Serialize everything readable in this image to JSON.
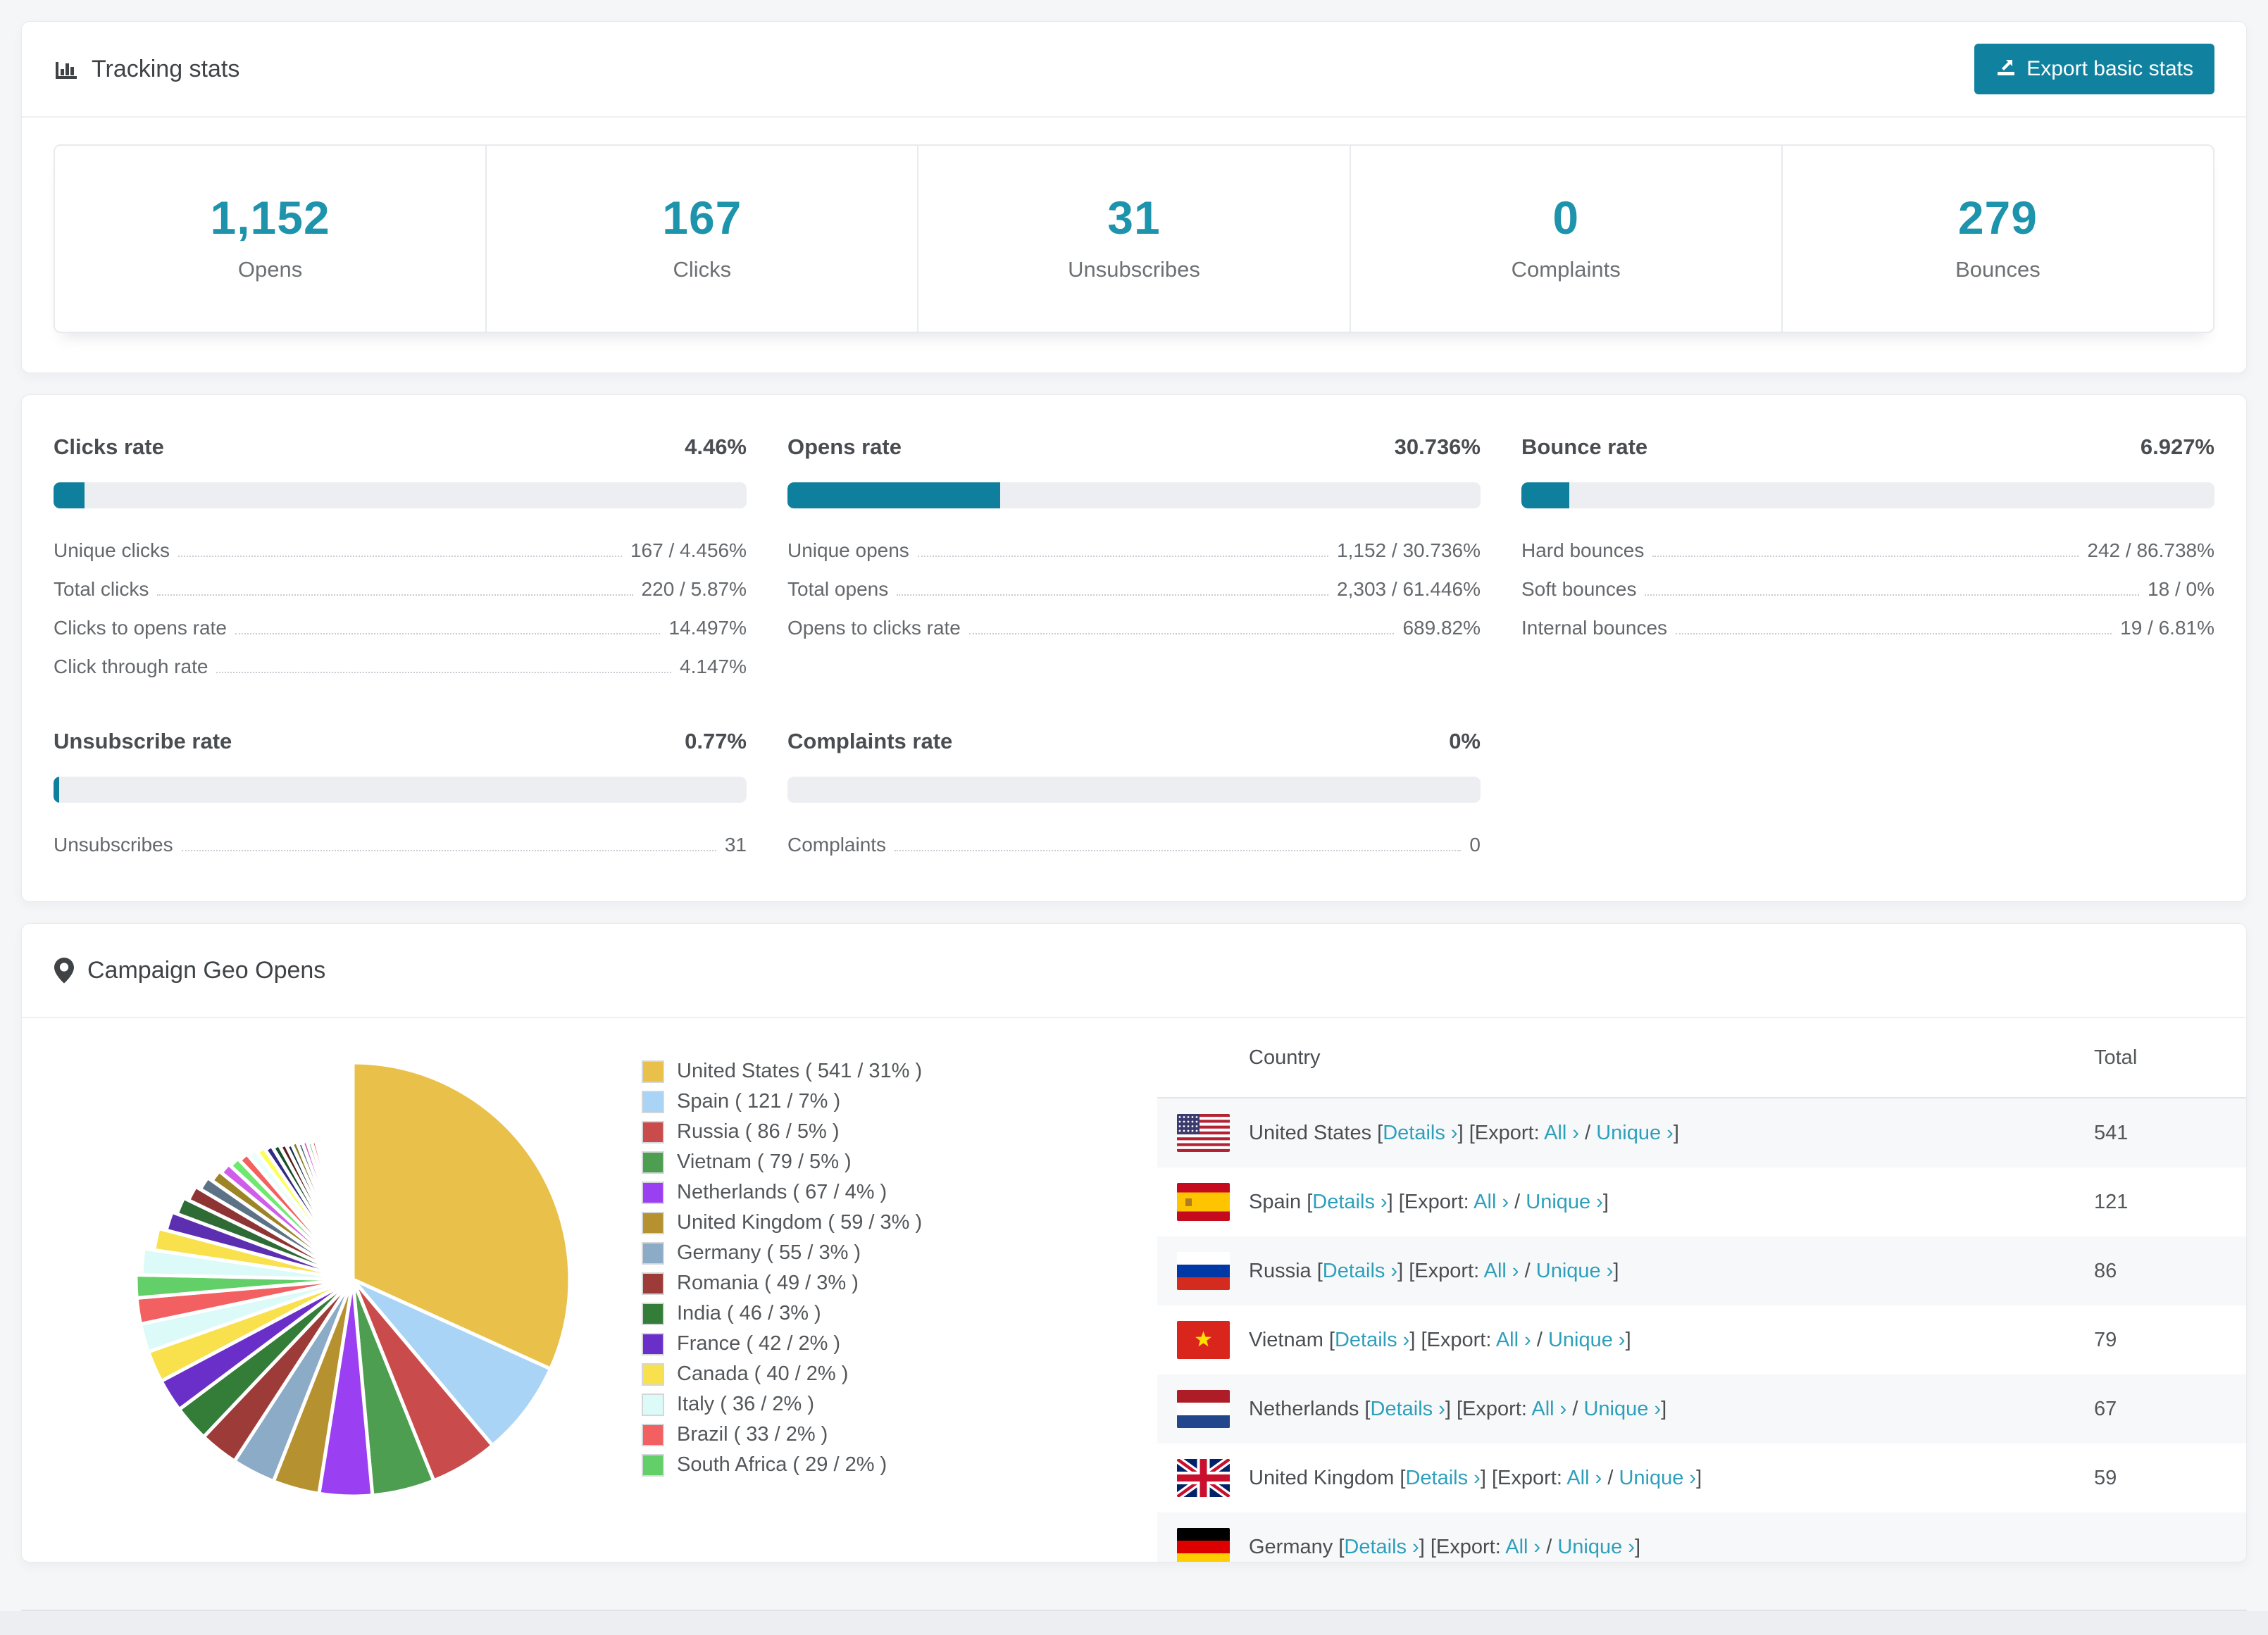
{
  "tracking": {
    "title": "Tracking stats",
    "export_button": "Export basic stats",
    "stats": [
      {
        "value": "1,152",
        "label": "Opens"
      },
      {
        "value": "167",
        "label": "Clicks"
      },
      {
        "value": "31",
        "label": "Unsubscribes"
      },
      {
        "value": "0",
        "label": "Complaints"
      },
      {
        "value": "279",
        "label": "Bounces"
      }
    ]
  },
  "rates": [
    {
      "title": "Clicks rate",
      "value": "4.46%",
      "pct": 4.46,
      "rows": [
        [
          "Unique clicks",
          "167 / 4.456%"
        ],
        [
          "Total clicks",
          "220 / 5.87%"
        ],
        [
          "Clicks to opens rate",
          "14.497%"
        ],
        [
          "Click through rate",
          "4.147%"
        ]
      ]
    },
    {
      "title": "Opens rate",
      "value": "30.736%",
      "pct": 30.736,
      "rows": [
        [
          "Unique opens",
          "1,152 / 30.736%"
        ],
        [
          "Total opens",
          "2,303 / 61.446%"
        ],
        [
          "Opens to clicks rate",
          "689.82%"
        ]
      ]
    },
    {
      "title": "Bounce rate",
      "value": "6.927%",
      "pct": 6.927,
      "rows": [
        [
          "Hard bounces",
          "242 / 86.738%"
        ],
        [
          "Soft bounces",
          "18 / 0%"
        ],
        [
          "Internal bounces",
          "19 / 6.81%"
        ]
      ]
    },
    {
      "title": "Unsubscribe rate",
      "value": "0.77%",
      "pct": 0.77,
      "rows": [
        [
          "Unsubscribes",
          "31"
        ]
      ]
    },
    {
      "title": "Complaints rate",
      "value": "0%",
      "pct": 0,
      "rows": [
        [
          "Complaints",
          "0"
        ]
      ]
    }
  ],
  "geo": {
    "title": "Campaign Geo Opens",
    "chart_data": {
      "type": "pie",
      "title": "Campaign Geo Opens",
      "legend_position": "right",
      "slices": [
        {
          "label": "United States",
          "value": 541,
          "pct": 31,
          "color": "#e8c04a"
        },
        {
          "label": "Spain",
          "value": 121,
          "pct": 7,
          "color": "#aad4f5"
        },
        {
          "label": "Russia",
          "value": 86,
          "pct": 5,
          "color": "#c94b4b"
        },
        {
          "label": "Vietnam",
          "value": 79,
          "pct": 5,
          "color": "#4d9e50"
        },
        {
          "label": "Netherlands",
          "value": 67,
          "pct": 4,
          "color": "#9b3ff2"
        },
        {
          "label": "United Kingdom",
          "value": 59,
          "pct": 3,
          "color": "#b5922f"
        },
        {
          "label": "Germany",
          "value": 55,
          "pct": 3,
          "color": "#8cabc6"
        },
        {
          "label": "Romania",
          "value": 49,
          "pct": 3,
          "color": "#9d3b38"
        },
        {
          "label": "India",
          "value": 46,
          "pct": 3,
          "color": "#337d39"
        },
        {
          "label": "France",
          "value": 42,
          "pct": 2,
          "color": "#6a2fc9"
        },
        {
          "label": "Canada",
          "value": 40,
          "pct": 2,
          "color": "#f8e14c"
        },
        {
          "label": "Italy",
          "value": 36,
          "pct": 2,
          "color": "#dbfaf8"
        },
        {
          "label": "Brazil",
          "value": 33,
          "pct": 2,
          "color": "#f26061"
        },
        {
          "label": "South Africa",
          "value": 29,
          "pct": 2,
          "color": "#63cf69"
        }
      ],
      "others_tail_values": [
        34,
        30,
        27,
        25,
        23,
        21,
        19,
        18,
        17,
        16,
        15,
        14,
        13,
        12,
        11,
        10,
        10,
        9,
        9,
        8,
        8,
        7,
        7,
        6,
        6,
        5,
        5,
        4,
        4,
        3,
        3,
        3,
        2,
        2,
        2,
        2,
        1,
        1,
        1,
        1,
        1,
        1,
        1,
        1,
        1,
        1
      ],
      "tail_colors": [
        "#dbfaf8",
        "#f8e14c",
        "#5b2fb0",
        "#2f6b35",
        "#8f3434",
        "#5c7286",
        "#9d8426",
        "#cf5fe8",
        "#6ee86e",
        "#f2605f",
        "#eafffb",
        "#fdff56",
        "#332b85",
        "#174f28",
        "#5e1d1d",
        "#12304e",
        "#857a1f",
        "#48606f",
        "#d44fd0",
        "#57c257",
        "#e05252",
        "#9cc8f0",
        "#d9b13b",
        "#a84fe8",
        "#3f8f46"
      ]
    },
    "legend": [
      {
        "label": "United States ( 541 / 31% )",
        "color": "#e8c04a"
      },
      {
        "label": "Spain ( 121 / 7% )",
        "color": "#aad4f5"
      },
      {
        "label": "Russia ( 86 / 5% )",
        "color": "#c94b4b"
      },
      {
        "label": "Vietnam ( 79 / 5% )",
        "color": "#4d9e50"
      },
      {
        "label": "Netherlands ( 67 / 4% )",
        "color": "#9b3ff2"
      },
      {
        "label": "United Kingdom ( 59 / 3% )",
        "color": "#b5922f"
      },
      {
        "label": "Germany ( 55 / 3% )",
        "color": "#8cabc6"
      },
      {
        "label": "Romania ( 49 / 3% )",
        "color": "#9d3b38"
      },
      {
        "label": "India ( 46 / 3% )",
        "color": "#337d39"
      },
      {
        "label": "France ( 42 / 2% )",
        "color": "#6a2fc9"
      },
      {
        "label": "Canada ( 40 / 2% )",
        "color": "#f8e14c"
      },
      {
        "label": "Italy ( 36 / 2% )",
        "color": "#dbfaf8"
      },
      {
        "label": "Brazil ( 33 / 2% )",
        "color": "#f26061"
      },
      {
        "label": "South Africa ( 29 / 2% )",
        "color": "#63cf69"
      }
    ],
    "table": {
      "headers": {
        "country": "Country",
        "total": "Total"
      },
      "tokens": {
        "lb": "[",
        "rb": "]",
        "details": "Details",
        "export": "Export:",
        "all": "All",
        "unique": "Unique",
        "chev": "›",
        "slash": "/"
      },
      "rows": [
        {
          "flag": "us",
          "country": "United States",
          "total": "541"
        },
        {
          "flag": "es",
          "country": "Spain",
          "total": "121"
        },
        {
          "flag": "ru",
          "country": "Russia",
          "total": "86"
        },
        {
          "flag": "vn",
          "country": "Vietnam",
          "total": "79"
        },
        {
          "flag": "nl",
          "country": "Netherlands",
          "total": "67"
        },
        {
          "flag": "gb",
          "country": "United Kingdom",
          "total": "59"
        },
        {
          "flag": "de",
          "country": "Germany",
          "total": ""
        }
      ]
    }
  }
}
